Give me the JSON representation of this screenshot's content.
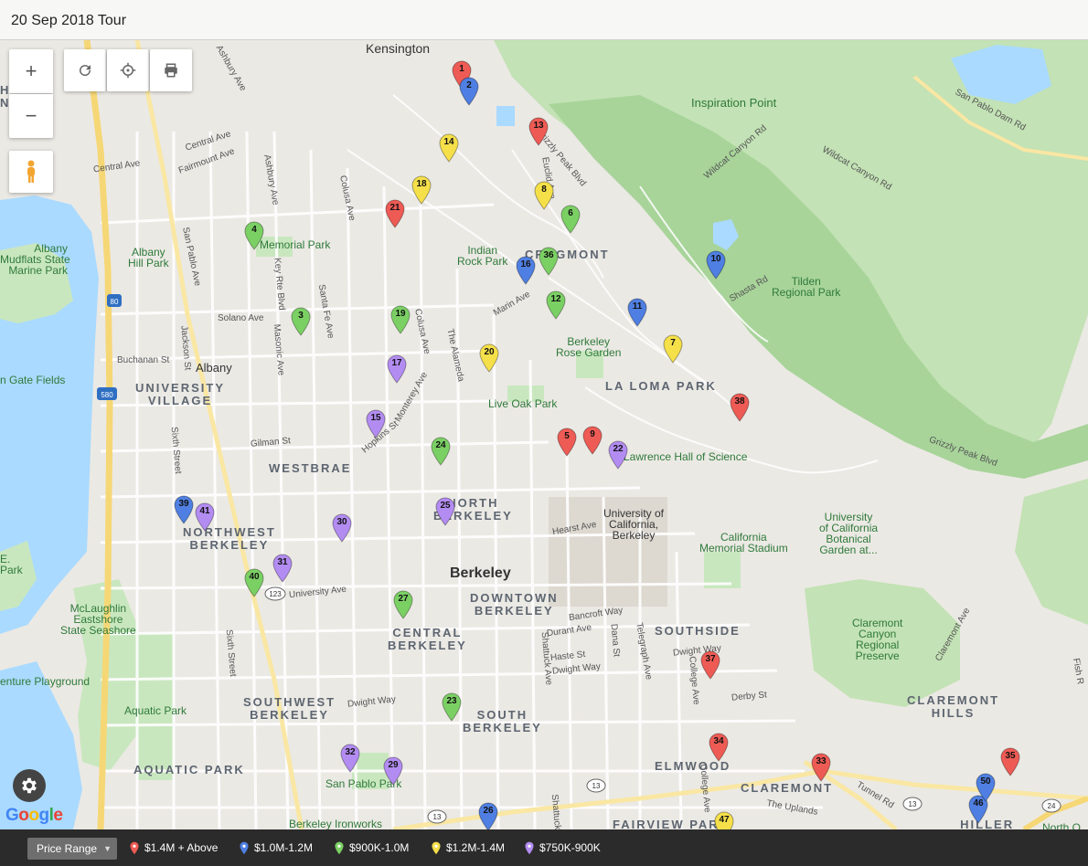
{
  "title": "20 Sep 2018 Tour",
  "map": {
    "controls": {
      "zoom_in": "+",
      "zoom_out": "−",
      "refresh": "refresh-icon",
      "locate": "crosshair-icon",
      "print": "print-icon",
      "pegman": "pegman-icon",
      "settings": "gear-icon"
    },
    "attribution": "Google",
    "labels": {
      "kensington": "Kensington",
      "inspiration_point": "Inspiration Point",
      "memorial_park": "Memorial Park",
      "albany_hill_park": "Albany\nHill Park",
      "albany_mudflats": "Albany\nMudflats State\nMarine Park",
      "indian_rock_park": "Indian\nRock Park",
      "cragmont": "CRAGMONT",
      "tilden": "Tilden\nRegional Park",
      "berkeley_rose_garden": "Berkeley\nRose Garden",
      "la_loma_park": "LA LOMA PARK",
      "albany": "Albany",
      "university_village": "UNIVERSITY\nVILLAGE",
      "gate_fields": "n Gate Fields",
      "live_oak_park": "Live Oak Park",
      "westbrae": "WESTBRAE",
      "lawrence_hall": "Lawrence Hall of Science",
      "north_berkeley": "NORTH\nBERKELEY",
      "northwest_berkeley": "NORTHWEST\nBERKELEY",
      "uc_berkeley": "University of\nCalifornia,\nBerkeley",
      "memorial_stadium": "California\nMemorial Stadium",
      "botanical_garden": "University\nof California\nBotanical\nGarden at...",
      "berkeley": "Berkeley",
      "downtown_berkeley": "DOWNTOWN\nBERKELEY",
      "central_berkeley": "CENTRAL\nBERKELEY",
      "southside": "SOUTHSIDE",
      "claremont_canyon": "Claremont\nCanyon\nRegional\nPreserve",
      "mclaughlin": "McLaughlin\nEastshore\nState Seashore",
      "e_park": "E.\nPark",
      "adventure_playground": "enture Playground",
      "aquatic_park_place": "Aquatic Park",
      "southwest_berkeley": "SOUTHWEST\nBERKELEY",
      "south_berkeley": "SOUTH\nBERKELEY",
      "claremont_hills": "CLAREMONT\nHILLS",
      "aquatic_park_area": "AQUATIC PARK",
      "elmwood": "ELMWOOD",
      "claremont": "CLAREMONT",
      "san_pablo_park": "San Pablo Park",
      "berkeley_ironworks": "Berkeley Ironworks",
      "fairview_park": "FAIRVIEW PARK",
      "hiller_highlands": "HILLER\nHIGHLANDS",
      "north_oakland_regional": "North O\nRegiona",
      "h_ner": "H\nNER"
    },
    "streets": {
      "ashbury": "Ashbury Ave",
      "central_ave_1": "Central Ave",
      "central_ave_2": "Central Ave",
      "fairmount": "Fairmount Ave",
      "ashbury_2": "Ashbury Ave",
      "colusa_1": "Colusa Ave",
      "san_pablo": "San Pablo Ave",
      "key_rte": "Key Rte Blvd",
      "santa_fe": "Santa Fe Ave",
      "solano": "Solano Ave",
      "masonic": "Masonic Ave",
      "colusa_2": "Colusa Ave",
      "the_alameda": "The Alameda",
      "marin": "Marin Ave",
      "buchanan": "Buchanan St",
      "jackson": "Jackson St",
      "monterey": "Monterey Ave",
      "hopkins": "Hopkins St",
      "gilman": "Gilman St",
      "sixth_1": "Sixth Street",
      "euclid": "Euclid Ave",
      "grizzly_peak_1": "Grizzly Peak Blvd",
      "shasta": "Shasta Rd",
      "wildcat_1": "Wildcat Canyon Rd",
      "wildcat_2": "Wildcat Canyon Rd",
      "san_pablo_dam": "San Pablo Dam Rd",
      "grizzly_peak_2": "Grizzly Peak Blvd",
      "hearst": "Hearst Ave",
      "university": "University Ave",
      "bancroft": "Bancroft Way",
      "durant": "Durant Ave",
      "haste": "Haste St",
      "dwight_1": "Dwight Way",
      "dwight_2": "Dwight Way",
      "dwight_3": "Dwight Way",
      "shattuck_1": "Shattuck Ave",
      "dana": "Dana St",
      "telegraph": "Telegraph Ave",
      "college_1": "College Ave",
      "derby": "Derby St",
      "sixth_2": "Sixth Street",
      "claremont_ave": "Claremont Ave",
      "fish_ranch": "Fish R",
      "tunnel": "Tunnel Rd",
      "college_2": "College Ave",
      "the_uplands": "The Uplands",
      "shattuck_2": "Shattuck"
    },
    "shields": {
      "i80": "80",
      "i580": "580",
      "ca123_1": "123",
      "ca13_1": "13",
      "ca13_2": "13",
      "ca13_3": "13",
      "ca24": "24"
    },
    "markers": [
      {
        "n": "1",
        "color": "#ee5b55"
      },
      {
        "n": "2",
        "color": "#4f7fe2"
      },
      {
        "n": "3",
        "color": "#7bd064"
      },
      {
        "n": "4",
        "color": "#7bd064"
      },
      {
        "n": "5",
        "color": "#ee5b55"
      },
      {
        "n": "6",
        "color": "#7bd064"
      },
      {
        "n": "7",
        "color": "#f5e04a"
      },
      {
        "n": "8",
        "color": "#f5e04a"
      },
      {
        "n": "9",
        "color": "#ee5b55"
      },
      {
        "n": "10",
        "color": "#4f7fe2"
      },
      {
        "n": "11",
        "color": "#4f7fe2"
      },
      {
        "n": "12",
        "color": "#7bd064"
      },
      {
        "n": "13",
        "color": "#ee5b55"
      },
      {
        "n": "14",
        "color": "#f5e04a"
      },
      {
        "n": "15",
        "color": "#b38cf2"
      },
      {
        "n": "16",
        "color": "#4f7fe2"
      },
      {
        "n": "17",
        "color": "#b38cf2"
      },
      {
        "n": "18",
        "color": "#f5e04a"
      },
      {
        "n": "19",
        "color": "#7bd064"
      },
      {
        "n": "20",
        "color": "#f5e04a"
      },
      {
        "n": "21",
        "color": "#ee5b55"
      },
      {
        "n": "22",
        "color": "#b38cf2"
      },
      {
        "n": "23",
        "color": "#7bd064"
      },
      {
        "n": "24",
        "color": "#7bd064"
      },
      {
        "n": "25",
        "color": "#b38cf2"
      },
      {
        "n": "26",
        "color": "#4f7fe2"
      },
      {
        "n": "27",
        "color": "#7bd064"
      },
      {
        "n": "29",
        "color": "#b38cf2"
      },
      {
        "n": "30",
        "color": "#b38cf2"
      },
      {
        "n": "31",
        "color": "#b38cf2"
      },
      {
        "n": "32",
        "color": "#b38cf2"
      },
      {
        "n": "33",
        "color": "#ee5b55"
      },
      {
        "n": "34",
        "color": "#ee5b55"
      },
      {
        "n": "35",
        "color": "#ee5b55"
      },
      {
        "n": "36",
        "color": "#7bd064"
      },
      {
        "n": "37",
        "color": "#ee5b55"
      },
      {
        "n": "38",
        "color": "#ee5b55"
      },
      {
        "n": "39",
        "color": "#4f7fe2"
      },
      {
        "n": "40",
        "color": "#7bd064"
      },
      {
        "n": "41",
        "color": "#b38cf2"
      },
      {
        "n": "46",
        "color": "#4f7fe2"
      },
      {
        "n": "47",
        "color": "#f5e04a"
      },
      {
        "n": "50",
        "color": "#4f7fe2"
      }
    ]
  },
  "footer": {
    "price_range_label": "Price Range",
    "legend": [
      {
        "label": "$1.4M + Above",
        "color": "#ee5b55"
      },
      {
        "label": "$1.0M-1.2M",
        "color": "#4f7fe2"
      },
      {
        "label": "$900K-1.0M",
        "color": "#7bd064"
      },
      {
        "label": "$1.2M-1.4M",
        "color": "#f5e04a"
      },
      {
        "label": "$750K-900K",
        "color": "#b38cf2"
      }
    ]
  }
}
